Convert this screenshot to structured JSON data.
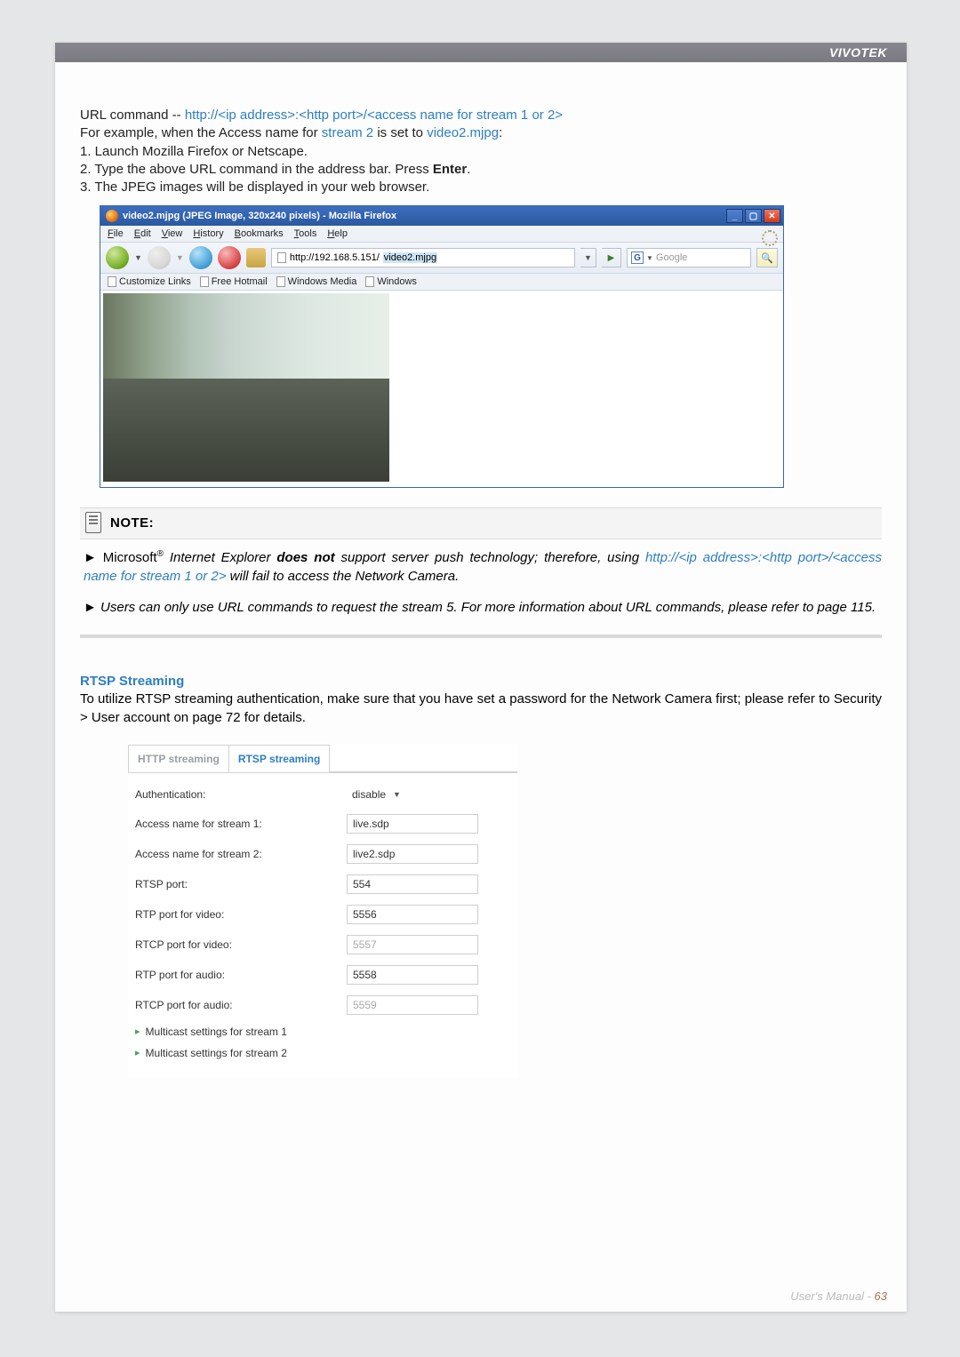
{
  "brand": "VIVOTEK",
  "urlcmd": {
    "prefix": "URL command -- ",
    "url_template": "http://<ip address>:<http port>/<access name for stream 1 or 2>",
    "example_prefix": "For example, when the Access name for ",
    "stream_label": "stream 2",
    "example_mid": " is set to ",
    "example_val": "video2.mjpg",
    "example_suffix": ":",
    "step1": "1. Launch Mozilla Firefox or Netscape.",
    "step2_a": "2. Type the above URL command in the address bar. Press ",
    "step2_b": "Enter",
    "step2_c": ".",
    "step3": "3. The JPEG images will be displayed in your web browser."
  },
  "ff": {
    "title": "video2.mjpg (JPEG Image, 320x240 pixels) - Mozilla Firefox",
    "menu": [
      "File",
      "Edit",
      "View",
      "History",
      "Bookmarks",
      "Tools",
      "Help"
    ],
    "addr_prefix": "http://192.168.5.151/",
    "addr_hl": "video2.mjpg",
    "search_placeholder": "Google",
    "bookmarks": [
      "Customize Links",
      "Free Hotmail",
      "Windows Media",
      "Windows"
    ]
  },
  "note": {
    "title": "NOTE:",
    "n1_a": "► Microsoft",
    "n1_sup": "®",
    "n1_b": " Internet Explorer ",
    "n1_bold": "does not",
    "n1_c": " support server push technology; therefore, using ",
    "n1_url": "http://<ip address>:<http port>/<access name for stream 1 or 2>",
    "n1_d": " will fail to access the Network Camera.",
    "n2": "► Users can only use URL commands to request the stream 5. For more information about URL commands, please refer to page 115."
  },
  "rtsp": {
    "title": "RTSP Streaming",
    "para": "To utilize RTSP streaming authentication, make sure that you have set a password for the Network Camera first; please refer to Security > User account on page 72 for details.",
    "tabs": {
      "http": "HTTP streaming",
      "rtsp": "RTSP streaming"
    },
    "fields": {
      "auth_lbl": "Authentication:",
      "auth_val": "disable",
      "s1_lbl": "Access name for stream 1:",
      "s1_val": "live.sdp",
      "s2_lbl": "Access name for stream 2:",
      "s2_val": "live2.sdp",
      "rtsp_lbl": "RTSP port:",
      "rtsp_val": "554",
      "rtpv_lbl": "RTP port for video:",
      "rtpv_val": "5556",
      "rtcpv_lbl": "RTCP port for video:",
      "rtcpv_val": "5557",
      "rtpa_lbl": "RTP port for audio:",
      "rtpa_val": "5558",
      "rtcpa_lbl": "RTCP port for audio:",
      "rtcpa_val": "5559",
      "mc1": "Multicast settings for stream 1",
      "mc2": "Multicast settings for stream 2"
    }
  },
  "footer": {
    "label": "User's Manual - ",
    "page": "63"
  }
}
